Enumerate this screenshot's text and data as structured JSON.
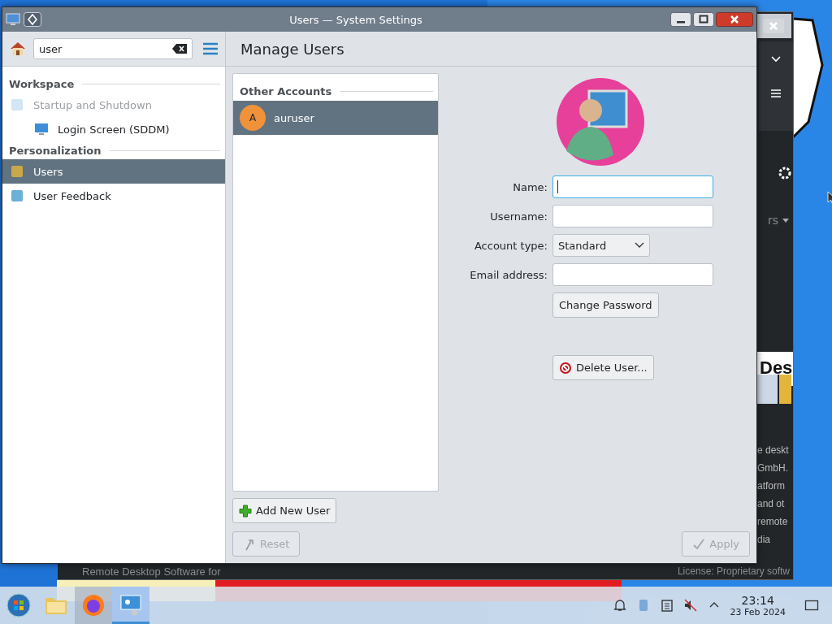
{
  "window": {
    "title": "Users — System Settings"
  },
  "sidebar": {
    "search": {
      "value": "user"
    },
    "sections": [
      {
        "title": "Workspace",
        "items": [
          {
            "label": "Startup and Shutdown",
            "disabled": true,
            "selected": false,
            "children": [
              {
                "label": "Login Screen (SDDM)",
                "disabled": false,
                "selected": false
              }
            ]
          }
        ]
      },
      {
        "title": "Personalization",
        "items": [
          {
            "label": "Users",
            "disabled": false,
            "selected": true
          },
          {
            "label": "User Feedback",
            "disabled": false,
            "selected": false
          }
        ]
      }
    ]
  },
  "page": {
    "title": "Manage Users",
    "accounts_group": "Other Accounts",
    "accounts": [
      {
        "initial": "A",
        "name": "auruser",
        "selected": true,
        "color": "#f0923a"
      }
    ],
    "form": [
      {
        "kind": "text",
        "label": "Name:",
        "focused": true
      },
      {
        "kind": "text",
        "label": "Username:",
        "focused": false
      },
      {
        "kind": "select",
        "label": "Account type:",
        "value": "Standard",
        "focused": false
      },
      {
        "kind": "text",
        "label": "Email address:",
        "focused": false
      }
    ],
    "change_password": "Change Password",
    "delete_user": "Delete User...",
    "add_user": "Add New User",
    "footer": [
      {
        "label": "Reset",
        "disabled": true
      },
      {
        "label": "Apply",
        "disabled": true
      }
    ]
  },
  "background_window": {
    "tab_label": "rs",
    "heading": "Des",
    "lines": [
      "e deskt",
      "GmbH.",
      "atform",
      "and ot",
      "remote",
      "dia"
    ],
    "footer_left": "Remote Desktop Software for",
    "footer_right": "License: Proprietary softw"
  },
  "taskbar": {
    "apps": [
      {
        "kind": "start",
        "active": false
      },
      {
        "kind": "files",
        "active": false
      },
      {
        "kind": "browser",
        "active": true
      },
      {
        "kind": "settings",
        "active": true
      }
    ],
    "time": "23:14",
    "date": "23 Feb 2024"
  }
}
